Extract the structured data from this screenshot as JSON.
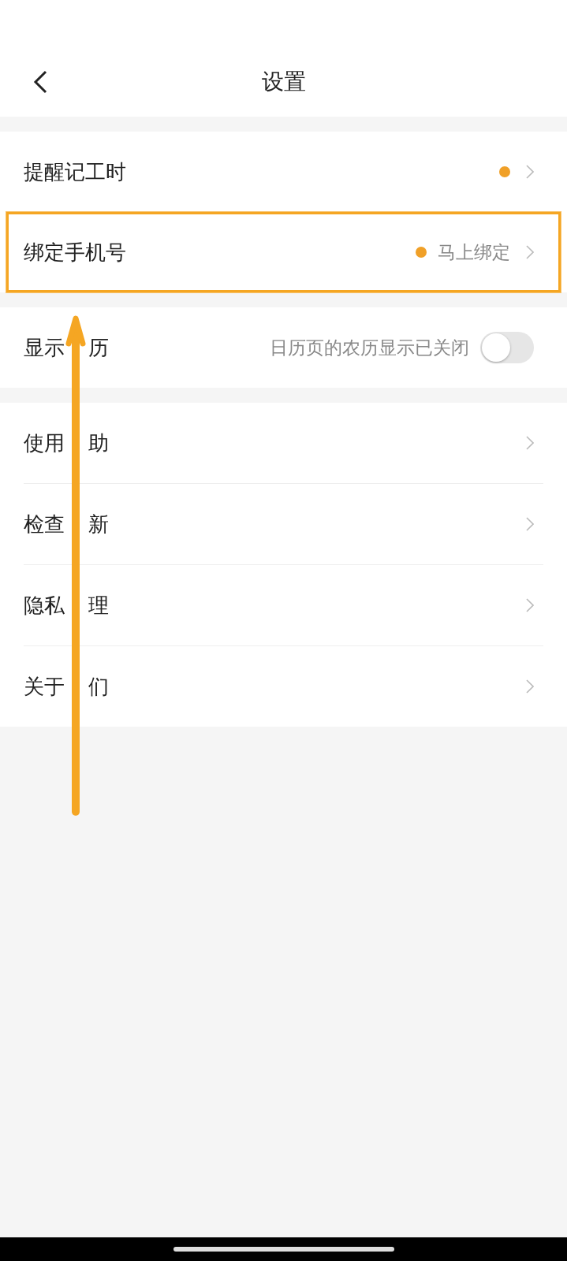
{
  "header": {
    "title": "设置"
  },
  "groups": [
    {
      "rows": [
        {
          "kind": "link",
          "label": [
            "提醒记工时"
          ],
          "dot": true,
          "value": "",
          "highlighted": false
        },
        {
          "kind": "link",
          "label": [
            "绑定手机号"
          ],
          "dot": true,
          "value": "马上绑定",
          "highlighted": true
        }
      ]
    },
    {
      "rows": [
        {
          "kind": "toggle",
          "label": [
            "显示",
            "历"
          ],
          "value": "日历页的农历显示已关闭",
          "on": false
        }
      ]
    },
    {
      "rows": [
        {
          "kind": "link",
          "label": [
            "使用",
            "助"
          ],
          "dot": false,
          "highlighted": false
        },
        {
          "kind": "link",
          "label": [
            "检查",
            "新"
          ],
          "dot": false,
          "highlighted": false
        },
        {
          "kind": "link",
          "label": [
            "隐私",
            "理"
          ],
          "dot": false,
          "highlighted": false
        },
        {
          "kind": "link",
          "label": [
            "关于",
            "们"
          ],
          "dot": false,
          "highlighted": false
        }
      ]
    }
  ]
}
